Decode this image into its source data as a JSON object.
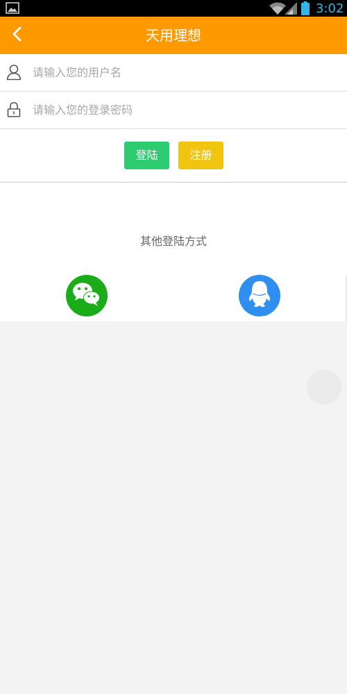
{
  "status_bar": {
    "time": "3:02",
    "icons": [
      "gallery-icon",
      "wifi-icon",
      "signal-icon",
      "battery-icon"
    ]
  },
  "header": {
    "title": "天用理想",
    "back_icon": "chevron-left-icon",
    "color": "#ff9900"
  },
  "form": {
    "username": {
      "placeholder": "请输入您的用户名",
      "value": "",
      "icon": "user-icon"
    },
    "password": {
      "placeholder": "请输入您的登录密码",
      "value": "",
      "icon": "lock-icon"
    },
    "login_label": "登陆",
    "register_label": "注册",
    "login_color": "#2ecc71",
    "register_color": "#f1c40f"
  },
  "other_login": {
    "label": "其他登陆方式",
    "providers": [
      {
        "name": "wechat",
        "icon": "wechat-icon",
        "color": "#1aad19"
      },
      {
        "name": "qq",
        "icon": "qq-icon",
        "color": "#2e8ff0"
      }
    ]
  }
}
